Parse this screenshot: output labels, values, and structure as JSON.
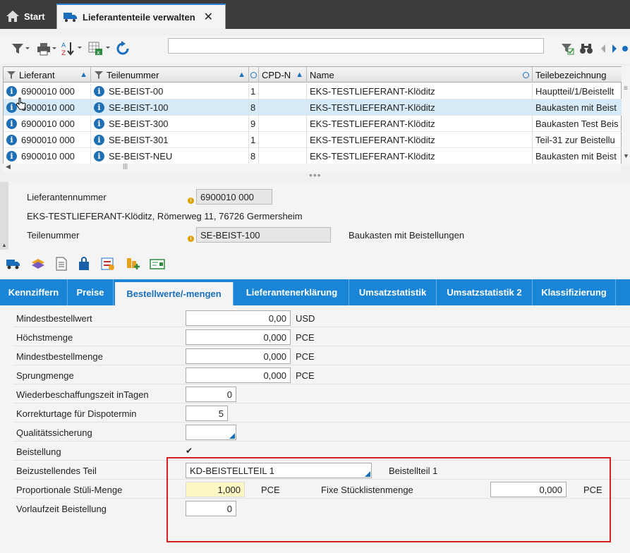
{
  "tabs": {
    "start": "Start",
    "active": "Lieferantenteile verwalten"
  },
  "grid": {
    "columns": [
      "Lieferant",
      "Teilenummer",
      "",
      "CPD-N",
      "Name",
      "Teilebezeichnung"
    ],
    "rows": [
      {
        "lieferant": "6900010 000",
        "teil": "SE-BEIST-00",
        "n": "1",
        "cpd": "",
        "name": "EKS-TESTLIEFERANT-Klöditz",
        "bez": "Hauptteil/1/Beistellt"
      },
      {
        "lieferant": "6900010 000",
        "teil": "SE-BEIST-100",
        "n": "8",
        "cpd": "",
        "name": "EKS-TESTLIEFERANT-Klöditz",
        "bez": "Baukasten mit Beist"
      },
      {
        "lieferant": "6900010 000",
        "teil": "SE-BEIST-300",
        "n": "9",
        "cpd": "",
        "name": "EKS-TESTLIEFERANT-Klöditz",
        "bez": "Baukasten Test Beis"
      },
      {
        "lieferant": "6900010 000",
        "teil": "SE-BEIST-301",
        "n": "1",
        "cpd": "",
        "name": "EKS-TESTLIEFERANT-Klöditz",
        "bez": "Teil-31 zur Beistellu"
      },
      {
        "lieferant": "6900010 000",
        "teil": "SE-BEIST-NEU",
        "n": "8",
        "cpd": "",
        "name": "EKS-TESTLIEFERANT-Klöditz",
        "bez": "Baukasten mit Beist"
      }
    ]
  },
  "detail": {
    "lief_label": "Lieferantennummer",
    "lief_value": "6900010 000",
    "address": "EKS-TESTLIEFERANT-Klöditz, Römerweg 11, 76726 Germersheim",
    "teil_label": "Teilenummer",
    "teil_value": "SE-BEIST-100",
    "teil_desc": "Baukasten mit Beistellungen"
  },
  "sectiontabs": [
    "Kennziffern",
    "Preise",
    "Bestellwerte/-mengen",
    "Lieferantenerklärung",
    "Umsatzstatistik",
    "Umsatzstatistik 2",
    "Klassifizierung"
  ],
  "form": {
    "mindestbestellwert": {
      "label": "Mindestbestellwert",
      "value": "0,00",
      "unit": "USD"
    },
    "hoechstmenge": {
      "label": "Höchstmenge",
      "value": "0,000",
      "unit": "PCE"
    },
    "mindestbestellmenge": {
      "label": "Mindestbestellmenge",
      "value": "0,000",
      "unit": "PCE"
    },
    "sprungmenge": {
      "label": "Sprungmenge",
      "value": "0,000",
      "unit": "PCE"
    },
    "wbz": {
      "label": "Wiederbeschaffungszeit inTagen",
      "value": "0"
    },
    "korrektur": {
      "label": "Korrekturtage für Dispotermin",
      "value": "5"
    },
    "qs": {
      "label": "Qualitätssicherung",
      "value": ""
    },
    "beistellung": {
      "label": "Beistellung",
      "checked": true
    },
    "beizust": {
      "label": "Beizustellendes Teil",
      "value": "KD-BEISTELLTEIL 1",
      "desc": "Beistellteil 1"
    },
    "prop": {
      "label": "Proportionale Stüli-Menge",
      "value": "1,000",
      "unit": "PCE"
    },
    "fixe": {
      "label": "Fixe Stücklistenmenge",
      "value": "0,000",
      "unit": "PCE"
    },
    "vorlauf": {
      "label": "Vorlaufzeit Beistellung",
      "value": "0"
    }
  }
}
